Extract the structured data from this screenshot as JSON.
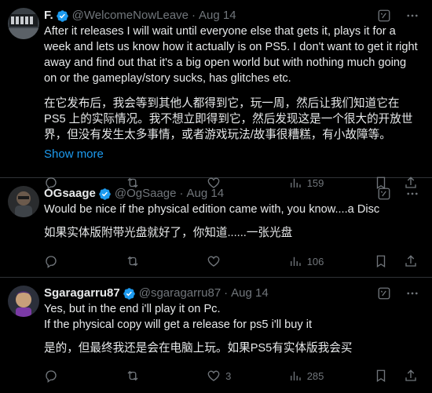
{
  "tweets": [
    {
      "name": "F.",
      "handle": "@WelcomeNowLeave",
      "time": "Aug 14",
      "text": [
        "After it releases I will wait until everyone else that gets it, plays it for a week and lets us know how it actually is on PS5. I don't want to get it right away and find out that it's a big open world but with nothing much going on or the gameplay/story sucks, has glitches etc.",
        "在它发布后，我会等到其他人都得到它，玩一周，然后让我们知道它在 PS5 上的实际情况。我不想立即得到它，然后发现这是一个很大的开放世界，但没有发生太多事情，或者游戏玩法/故事很糟糕，有小故障等。"
      ],
      "show_more": "Show more",
      "views": "159",
      "likes": ""
    },
    {
      "name": "OGsaage",
      "handle": "@OgSaage",
      "time": "Aug 14",
      "text": [
        "Would be nice if the physical edition came with, you know....a Disc",
        "如果实体版附带光盘就好了，你知道......一张光盘"
      ],
      "views": "106",
      "likes": ""
    },
    {
      "name": "Sgaragarru87",
      "handle": "@sgaragarru87",
      "time": "Aug 14",
      "text": [
        "Yes, but in the end i'll play it on Pc.\nIf the physical copy will get a release for ps5 i'll buy it",
        "是的，但最终我还是会在电脑上玩。如果PS5有实体版我会买"
      ],
      "views": "285",
      "likes": "3"
    }
  ],
  "colors": {
    "background": "#000000",
    "text": "#e7e9ea",
    "muted": "#71767b",
    "link": "#1d9bf0",
    "divider": "#2f3336"
  },
  "icons": [
    "verified-badge-icon",
    "grok-icon",
    "more-icon",
    "reply-icon",
    "retweet-icon",
    "like-icon",
    "views-icon",
    "bookmark-icon",
    "share-icon"
  ]
}
